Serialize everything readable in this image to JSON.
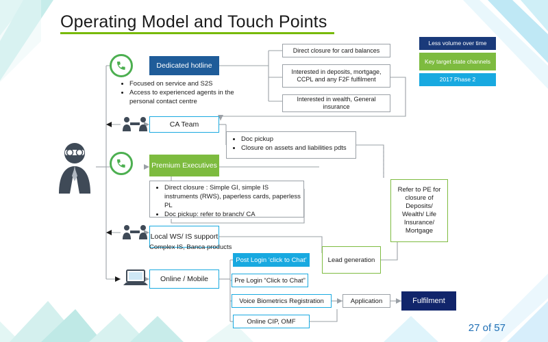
{
  "slide": {
    "title": "Operating Model and Touch Points",
    "page_number": "27 of 57",
    "accent_colors": {
      "title_rule": "#76b900",
      "blue_channel": "#1f5c99",
      "green_channel": "#7dbb3f",
      "cyan_channel": "#18a9e0",
      "fulfilment": "#11256b",
      "page_number": "#1f6fb5"
    }
  },
  "legend": [
    {
      "label": "Less volume over time",
      "color": "#1a3a7a"
    },
    {
      "label": "Key target state channels",
      "color": "#7dbb3f"
    },
    {
      "label": "2017 Phase 2",
      "color": "#18a9e0"
    }
  ],
  "channels": [
    {
      "id": "dedicated-hotline",
      "label": "Dedicated hotline",
      "style": "blue"
    },
    {
      "id": "ca-team",
      "label": "CA Team",
      "style": "outline"
    },
    {
      "id": "premium-executives",
      "label": "Premium Executives",
      "style": "green"
    },
    {
      "id": "local-ws-is-support",
      "label": "Local WS/ IS support",
      "style": "outline"
    },
    {
      "id": "online-mobile",
      "label": "Online / Mobile",
      "style": "outline"
    }
  ],
  "hotline_outcomes": [
    "Direct closure for card balances",
    "Interested in deposits, mortgage, CCPL and any F2F fulfilment",
    "Interested in wealth,  General insurance"
  ],
  "hotline_bullets": [
    "Focused on service and S2S",
    "Access to experienced agents in the personal contact centre"
  ],
  "ca_team_notes": [
    "Doc pickup",
    "Closure on assets and liabilities pdts"
  ],
  "premium_bullets": [
    "Direct closure : Simple GI, simple IS instruments (RWS), paperless cards, paperless PL",
    "Doc pickup: refer to branch/ CA"
  ],
  "local_support_note": "Complex IS, Banca products",
  "refer_box": "Refer to PE for closure of Deposits/ Wealth/ Life Insurance/ Mortgage",
  "online_items": [
    {
      "label": "Post Login ‘click to Chat’",
      "style": "filled-cyan"
    },
    {
      "label": "Pre Login “Click to Chat”",
      "style": "outline-cyan"
    },
    {
      "label": "Voice Biometrics Registration",
      "style": "outline-cyan"
    },
    {
      "label": "Online CIP, OMF",
      "style": "outline-cyan"
    }
  ],
  "lead_generation": "Lead generation",
  "application": "Application",
  "fulfilment": "Fulfilment",
  "icons": {
    "person": "customer-person-icon",
    "phone_hotline": "phone-icon",
    "phone_premium": "phone-icon",
    "agents_ca": "agents-pair-icon",
    "agents_local": "agents-pair-icon",
    "laptop": "laptop-icon"
  }
}
